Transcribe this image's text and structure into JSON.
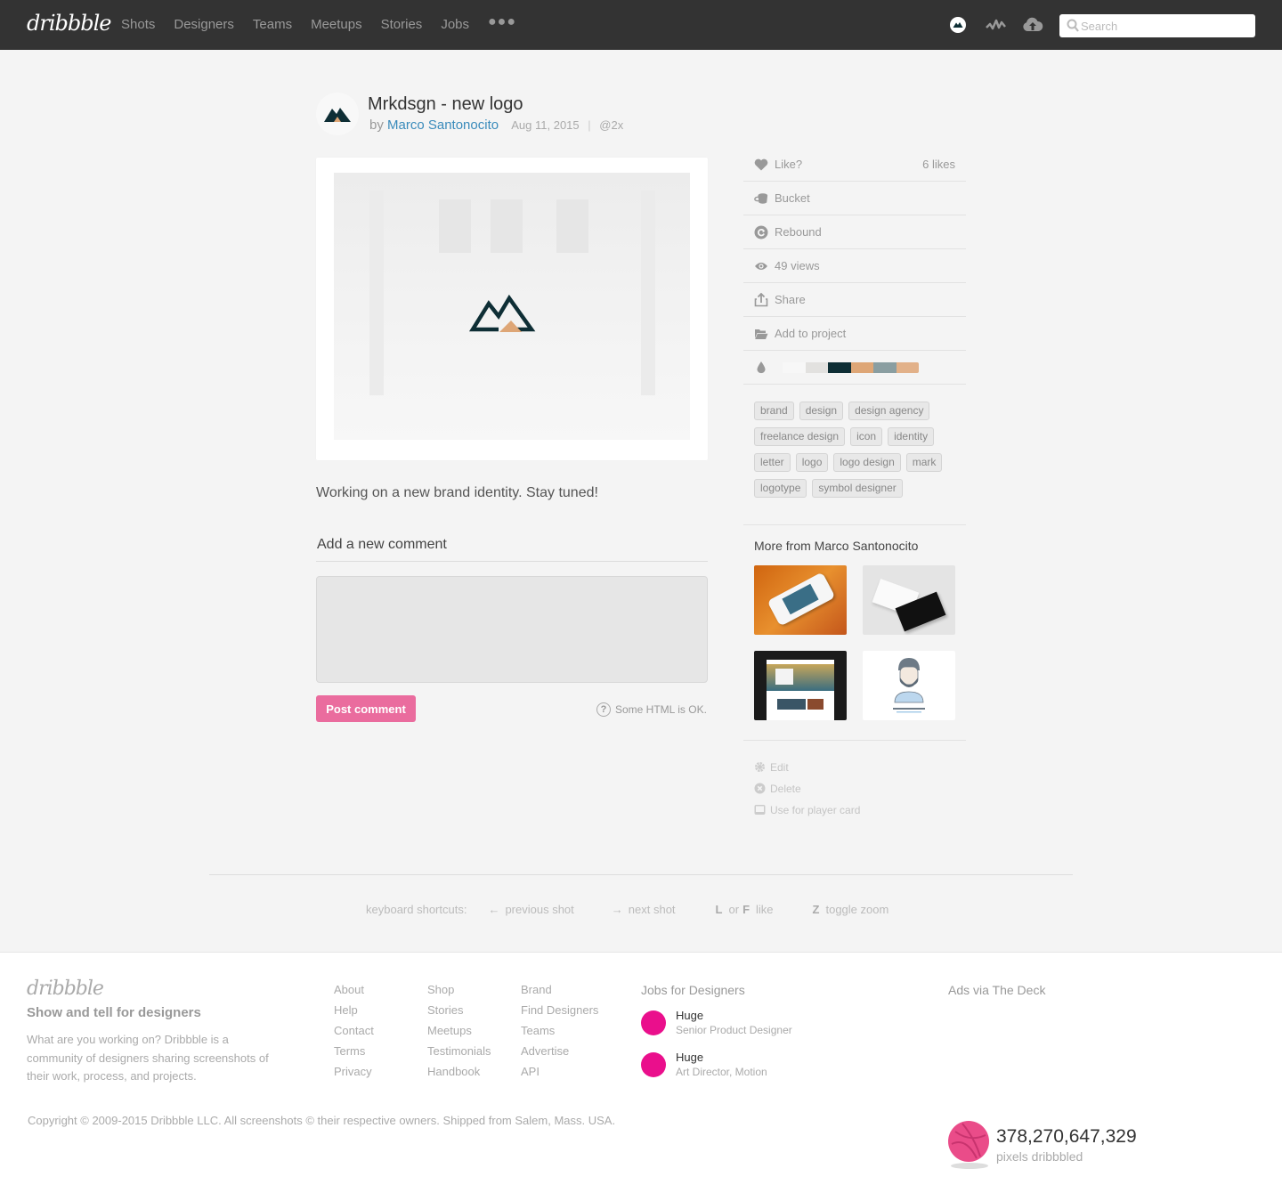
{
  "header": {
    "logo": "dribbble",
    "nav": [
      "Shots",
      "Designers",
      "Teams",
      "Meetups",
      "Stories",
      "Jobs"
    ],
    "more_icon": "ellipsis-icon",
    "icons": [
      "user-avatar-icon",
      "activity-icon",
      "upload-cloud-icon"
    ],
    "search_placeholder": "Search"
  },
  "shot": {
    "title": "Mrkdsgn - new logo",
    "by": "by",
    "author": "Marco Santonocito",
    "date": "Aug 11, 2015",
    "separator": "|",
    "resolution": "@2x",
    "description": "Working on a new brand identity. Stay tuned!"
  },
  "comment": {
    "heading": "Add a new comment",
    "textarea_value": "",
    "post_label": "Post comment",
    "help_icon": "?",
    "help_text": "Some HTML is OK."
  },
  "sidebar": {
    "like_label": "Like?",
    "likes_count": "6 likes",
    "bucket_label": "Bucket",
    "rebound_label": "Rebound",
    "views_label": "49 views",
    "share_label": "Share",
    "project_label": "Add to project",
    "colors": [
      "#f7f7f7",
      "#e2e1df",
      "#0e2e35",
      "#dea676",
      "#8a9ea1",
      "#e2b189"
    ],
    "tags": [
      "brand",
      "design",
      "design agency",
      "freelance design",
      "icon",
      "identity",
      "letter",
      "logo",
      "logo design",
      "mark",
      "logotype",
      "symbol designer"
    ],
    "more_heading": "More from Marco Santonocito",
    "admin": [
      "Edit",
      "Delete",
      "Use for player card"
    ]
  },
  "shortcuts": {
    "label": "keyboard shortcuts:",
    "prev_key": "←",
    "prev": "previous shot",
    "next_key": "→",
    "next": "next shot",
    "like_key1": "L",
    "like_or": "or",
    "like_key2": "F",
    "like": "like",
    "zoom_key": "Z",
    "zoom": "toggle zoom"
  },
  "footer": {
    "logo": "dribbble",
    "tagline": "Show and tell for designers",
    "about": "What are you working on? Dribbble is a community of designers sharing screenshots of their work, process, and projects.",
    "col1": [
      "About",
      "Help",
      "Contact",
      "Terms",
      "Privacy"
    ],
    "col2": [
      "Shop",
      "Stories",
      "Meetups",
      "Testimonials",
      "Handbook"
    ],
    "col3": [
      "Brand",
      "Find Designers",
      "Teams",
      "Advertise",
      "API"
    ],
    "jobs_heading": "Jobs for Designers",
    "jobs": [
      {
        "company": "Huge",
        "role": "Senior Product Designer"
      },
      {
        "company": "Huge",
        "role": "Art Director, Motion"
      }
    ],
    "ads_heading": "Ads via The Deck",
    "copyright": "Copyright © 2009-2015 Dribbble LLC. All screenshots © their respective owners. Shipped from Salem, Mass. USA.",
    "pixels_count": "378,270,647,329",
    "pixels_label": "pixels dribbbled"
  }
}
